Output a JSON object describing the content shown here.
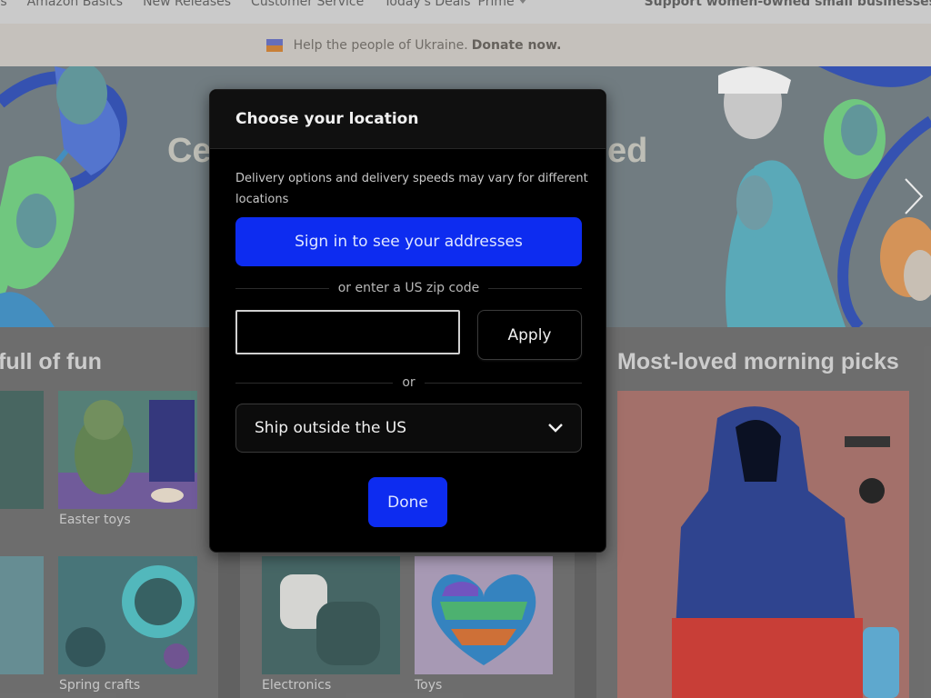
{
  "nav": {
    "items": [
      "ers",
      "Amazon Basics",
      "New Releases",
      "Customer Service",
      "Today's Deals",
      "Prime"
    ],
    "right": "Support women-owned small businesses"
  },
  "banner": {
    "text": "Help the people of Ukraine.",
    "link": "Donate now."
  },
  "hero": {
    "title_left": "Ce",
    "title_right": "ed"
  },
  "cards": {
    "left_title": "full of fun",
    "right_title": "Most-loved morning picks",
    "tiles": [
      "Easter toys",
      "Spring crafts",
      "Electronics",
      "Toys"
    ]
  },
  "modal": {
    "title": "Choose your location",
    "description": "Delivery options and delivery speeds may vary for different locations",
    "signin_label": "Sign in to see your addresses",
    "zip_divider": "or enter a US zip code",
    "zip_value": "",
    "apply_label": "Apply",
    "or_divider": "or",
    "ship_select_label": "Ship outside the US",
    "done_label": "Done"
  },
  "colors": {
    "primary_button": "#0d2cf0",
    "modal_background": "#000000"
  }
}
